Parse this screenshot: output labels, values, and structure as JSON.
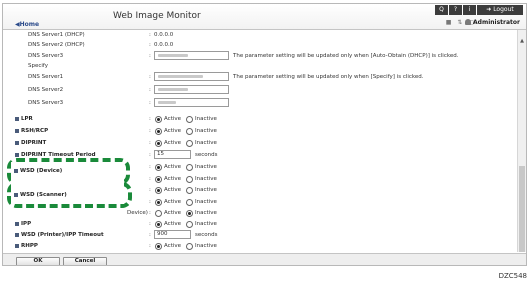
{
  "header": {
    "title": "Web Image Monitor",
    "home_label": "Home",
    "logout_label": "Logout",
    "help_label": "?",
    "info_label": "i",
    "search_label": "Q",
    "user_label": "Administrator"
  },
  "dns_rows": [
    {
      "label": "DNS Server1 (DHCP)",
      "value": "0.0.0.0"
    },
    {
      "label": "DNS Server2 (DHCP)",
      "value": "0.0.0.0"
    },
    {
      "label": "DNS Server3",
      "note": "The parameter setting will be updated only when [Auto-Obtain (DHCP)] is clicked."
    },
    {
      "label": "Specify"
    },
    {
      "label": "DNS Server1",
      "note": "The parameter setting will be updated only when [Specify] is clicked."
    },
    {
      "label": "DNS Server2"
    },
    {
      "label": "DNS Server3"
    }
  ],
  "radio_options": {
    "active": "Active",
    "inactive": "Inactive"
  },
  "settings": [
    {
      "label": "LPR",
      "type": "radio",
      "selected": "active"
    },
    {
      "label": "RSH/RCP",
      "type": "radio",
      "selected": "active"
    },
    {
      "label": "DIPRINT",
      "type": "radio",
      "selected": "active"
    },
    {
      "label": "DIPRINT Timeout Period",
      "type": "input",
      "value": "15",
      "unit": "seconds"
    },
    {
      "label": "WSD (Device)",
      "type": "radio",
      "selected": "active"
    },
    {
      "label": "WSD (Printer)",
      "type": "radio",
      "selected": "active"
    },
    {
      "label": "WSD (Scanner)",
      "type": "radio",
      "selected": "active"
    },
    {
      "label": "WSD (Printer) Discovery (Device)",
      "type": "radio",
      "selected": "inactive"
    },
    {
      "label": "IPP",
      "type": "radio",
      "selected": "active"
    },
    {
      "label": "WSD (Printer)/IPP Timeout",
      "type": "input",
      "value": "900",
      "unit": "seconds"
    },
    {
      "label": "RHPP",
      "type": "radio",
      "selected": "active"
    }
  ],
  "footer": {
    "ok_label": "OK",
    "cancel_label": "Cancel"
  },
  "figure_id": "DZC548",
  "colors": {
    "highlight_dash": "#1a8a3a",
    "bullet": "#4a5b7a",
    "toolbar_button": "#3c3c3c"
  }
}
